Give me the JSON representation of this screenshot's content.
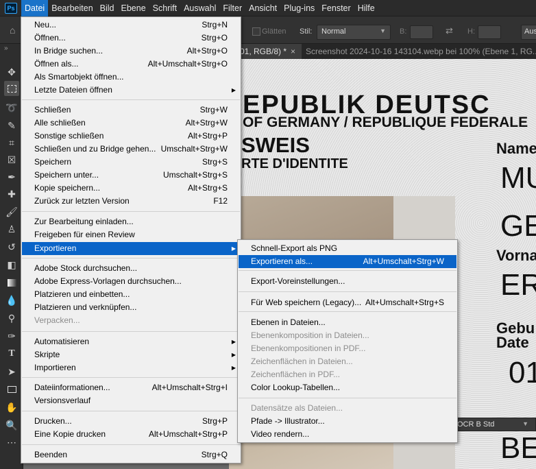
{
  "app": {
    "logo": "Ps"
  },
  "menubar": [
    {
      "label": "Datei",
      "active": true
    },
    {
      "label": "Bearbeiten"
    },
    {
      "label": "Bild"
    },
    {
      "label": "Ebene"
    },
    {
      "label": "Schrift"
    },
    {
      "label": "Auswahl"
    },
    {
      "label": "Filter"
    },
    {
      "label": "Ansicht"
    },
    {
      "label": "Plug-ins"
    },
    {
      "label": "Fenster"
    },
    {
      "label": "Hilfe"
    }
  ],
  "options": {
    "glaetten": "Glätten",
    "stil_label": "Stil:",
    "stil_value": "Normal",
    "b_label": "B:",
    "h_label": "H:",
    "aus": "Aus"
  },
  "tabs": [
    {
      "label": "01, RGB/8) *",
      "close": "×"
    },
    {
      "label": "Screenshot 2024-10-16 143104.webp bei 100% (Ebene 1, RG...",
      "close": ""
    }
  ],
  "toolbar": {
    "collapse": "»"
  },
  "document": {
    "title": "EPUBLIK DEUTSC",
    "subtitle": "OF GERMANY / REPUBLIQUE FEDERALE",
    "ausweis": "SWEIS",
    "carte": "RTE D'IDENTITE",
    "name_label": "Name",
    "name_value_1": "MU",
    "name_value_2": "GE",
    "vorname_label": "Vorna",
    "vorname_value": "ER",
    "geburt_label": "Gebu",
    "date_label": "Date",
    "date_value": "01",
    "place_value": "BE"
  },
  "status": {
    "font": "OCR B Std"
  },
  "datei_menu": {
    "items": [
      {
        "label": "Neu...",
        "shortcut": "Strg+N"
      },
      {
        "label": "Öffnen...",
        "shortcut": "Strg+O"
      },
      {
        "label": "In Bridge suchen...",
        "shortcut": "Alt+Strg+O"
      },
      {
        "label": "Öffnen als...",
        "shortcut": "Alt+Umschalt+Strg+O"
      },
      {
        "label": "Als Smartobjekt öffnen...",
        "shortcut": ""
      },
      {
        "label": "Letzte Dateien öffnen",
        "shortcut": "",
        "submenu": true
      },
      {
        "label": "Schließen",
        "shortcut": "Strg+W"
      },
      {
        "label": "Alle schließen",
        "shortcut": "Alt+Strg+W"
      },
      {
        "label": "Sonstige schließen",
        "shortcut": "Alt+Strg+P"
      },
      {
        "label": "Schließen und zu Bridge gehen...",
        "shortcut": "Umschalt+Strg+W"
      },
      {
        "label": "Speichern",
        "shortcut": "Strg+S"
      },
      {
        "label": "Speichern unter...",
        "shortcut": "Umschalt+Strg+S"
      },
      {
        "label": "Kopie speichern...",
        "shortcut": "Alt+Strg+S"
      },
      {
        "label": "Zurück zur letzten Version",
        "shortcut": "F12"
      },
      {
        "label": "Zur Bearbeitung einladen...",
        "shortcut": ""
      },
      {
        "label": "Freigeben für einen Review",
        "shortcut": ""
      },
      {
        "label": "Exportieren",
        "shortcut": "",
        "submenu": true,
        "highlighted": true
      },
      {
        "label": "Adobe Stock durchsuchen...",
        "shortcut": ""
      },
      {
        "label": "Adobe Express-Vorlagen durchsuchen...",
        "shortcut": ""
      },
      {
        "label": "Platzieren und einbetten...",
        "shortcut": ""
      },
      {
        "label": "Platzieren und verknüpfen...",
        "shortcut": ""
      },
      {
        "label": "Verpacken...",
        "shortcut": "",
        "disabled": true
      },
      {
        "label": "Automatisieren",
        "shortcut": "",
        "submenu": true
      },
      {
        "label": "Skripte",
        "shortcut": "",
        "submenu": true
      },
      {
        "label": "Importieren",
        "shortcut": "",
        "submenu": true
      },
      {
        "label": "Dateiinformationen...",
        "shortcut": "Alt+Umschalt+Strg+I"
      },
      {
        "label": "Versionsverlauf",
        "shortcut": ""
      },
      {
        "label": "Drucken...",
        "shortcut": "Strg+P"
      },
      {
        "label": "Eine Kopie drucken",
        "shortcut": "Alt+Umschalt+Strg+P"
      },
      {
        "label": "Beenden",
        "shortcut": "Strg+Q"
      }
    ]
  },
  "export_menu": {
    "items": [
      {
        "label": "Schnell-Export als PNG",
        "shortcut": ""
      },
      {
        "label": "Exportieren als...",
        "shortcut": "Alt+Umschalt+Strg+W",
        "highlighted": true
      },
      {
        "label": "Export-Voreinstellungen...",
        "shortcut": ""
      },
      {
        "label": "Für Web speichern (Legacy)...",
        "shortcut": "Alt+Umschalt+Strg+S"
      },
      {
        "label": "Ebenen in Dateien...",
        "shortcut": ""
      },
      {
        "label": "Ebenenkomposition in Dateien...",
        "shortcut": "",
        "disabled": true
      },
      {
        "label": "Ebenenkompositionen in PDF...",
        "shortcut": "",
        "disabled": true
      },
      {
        "label": "Zeichenflächen in Dateien...",
        "shortcut": "",
        "disabled": true
      },
      {
        "label": "Zeichenflächen in PDF...",
        "shortcut": "",
        "disabled": true
      },
      {
        "label": "Color Lookup-Tabellen...",
        "shortcut": ""
      },
      {
        "label": "Datensätze als Dateien...",
        "shortcut": "",
        "disabled": true
      },
      {
        "label": "Pfade -> Illustrator...",
        "shortcut": ""
      },
      {
        "label": "Video rendern...",
        "shortcut": ""
      }
    ]
  },
  "colors": {
    "highlight": "#0a64c8",
    "menubar_active": "#1a73c9",
    "menu_bg": "#f0f0f0"
  }
}
